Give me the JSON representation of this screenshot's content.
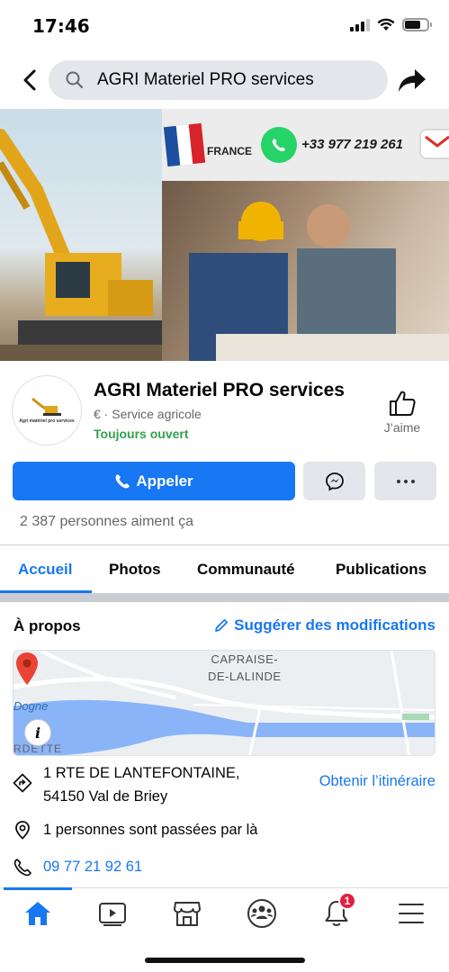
{
  "status_bar": {
    "time": "17:46"
  },
  "search": {
    "query": "AGRI Materiel PRO services"
  },
  "cover": {
    "country_label": "FRANCE",
    "phone_label": "+33 977 219 261"
  },
  "profile": {
    "name": "AGRI Materiel PRO services",
    "category": "€ · Service agricole",
    "status": "Toujours ouvert",
    "like_label": "J’aime",
    "avatar_caption": "Agri matériel pro services"
  },
  "actions": {
    "call_label": "Appeler"
  },
  "likes_count": "2 387 personnes aiment ça",
  "tabs": [
    {
      "label": "Accueil",
      "active": true
    },
    {
      "label": "Photos",
      "active": false
    },
    {
      "label": "Communauté",
      "active": false
    },
    {
      "label": "Publications",
      "active": false
    }
  ],
  "about": {
    "title": "À propos",
    "suggest_label": "Suggérer des modifications",
    "map": {
      "label_town_1": "CAPRAISE-",
      "label_town_2": "DE-LALINDE",
      "label_river": "Dogne",
      "label_bottom": "RDETTE"
    },
    "address_line1": "1 RTE DE LANTEFONTAINE,",
    "address_line2": "54150 Val de Briey",
    "directions_label": "Obtenir l’itinéraire",
    "checkins": "1 personnes sont passées par là",
    "phone": "09 77 21 92 61"
  },
  "bottom_nav": {
    "notifications_badge": "1"
  },
  "colors": {
    "accent": "#1877f2",
    "open_green": "#31a24c",
    "badge_red": "#e41e3f"
  }
}
